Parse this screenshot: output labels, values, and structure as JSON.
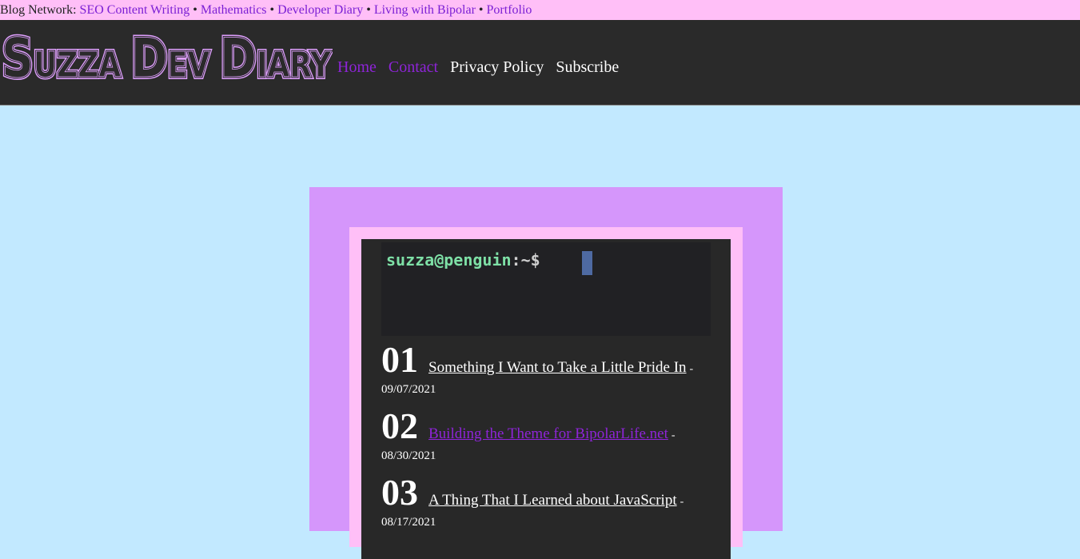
{
  "network": {
    "label": "Blog Network:",
    "links": [
      "SEO Content Writing",
      "Mathematics",
      "Developer Diary",
      "Living with Bipolar",
      "Portfolio"
    ],
    "separator": "•"
  },
  "header": {
    "logo_text": "Suzza Dev Diary",
    "nav": [
      "Home",
      "Contact",
      "Privacy Policy",
      "Subscribe"
    ]
  },
  "terminal": {
    "user": "suzza@penguin",
    "path": ":~$"
  },
  "posts": [
    {
      "num": "01",
      "title": "Something I Want to Take a Little Pride In",
      "dash": "-",
      "date": "09/07/2021"
    },
    {
      "num": "02",
      "title": "Building the Theme for BipolarLife.net",
      "dash": "-",
      "date": "08/30/2021"
    },
    {
      "num": "03",
      "title": "A Thing That I Learned about JavaScript",
      "dash": "-",
      "date": "08/17/2021"
    }
  ],
  "colors": {
    "page_bg": "#c2e9ff",
    "network_bar_bg": "#ffbff7",
    "header_bg": "#2a2a2a",
    "accent_purple": "#8e24d8",
    "frame_purple": "#d596fb",
    "frame_pink": "#ffbff7",
    "card_bg": "#282828"
  }
}
